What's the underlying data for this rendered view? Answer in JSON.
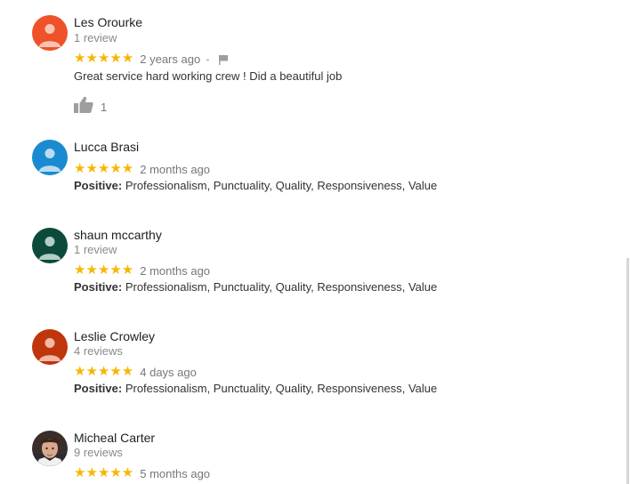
{
  "reviews": [
    {
      "name": "Les Orourke",
      "review_count": "1 review",
      "stars": "★★★★★",
      "time": "2 years ago",
      "dash": "-",
      "text": "Great service hard working crew ! Did a beautiful job",
      "likes": "1",
      "avatar_color": "#ef5128"
    },
    {
      "name": "Lucca Brasi",
      "stars": "★★★★★",
      "time": "2 months ago",
      "positive_label": "Positive:",
      "positive_values": "Professionalism, Punctuality, Quality, Responsiveness, Value",
      "avatar_color": "#1a8bd0"
    },
    {
      "name": "shaun mccarthy",
      "review_count": "1 review",
      "stars": "★★★★★",
      "time": "2 months ago",
      "positive_label": "Positive:",
      "positive_values": "Professionalism, Punctuality, Quality, Responsiveness, Value",
      "avatar_color": "#0c4a3c"
    },
    {
      "name": "Leslie Crowley",
      "review_count": "4 reviews",
      "stars": "★★★★★",
      "time": "4 days ago",
      "positive_label": "Positive:",
      "positive_values": "Professionalism, Punctuality, Quality, Responsiveness, Value",
      "avatar_color": "#bf360c"
    },
    {
      "name": "Micheal Carter",
      "review_count": "9 reviews",
      "stars": "★★★★★",
      "time": "5 months ago"
    }
  ],
  "colors": {
    "star": "#f7b600",
    "muted": "#8a8a8a"
  },
  "icons": {
    "flag": "flag-icon",
    "like": "thumbs-up-icon",
    "avatar": "person-icon"
  }
}
